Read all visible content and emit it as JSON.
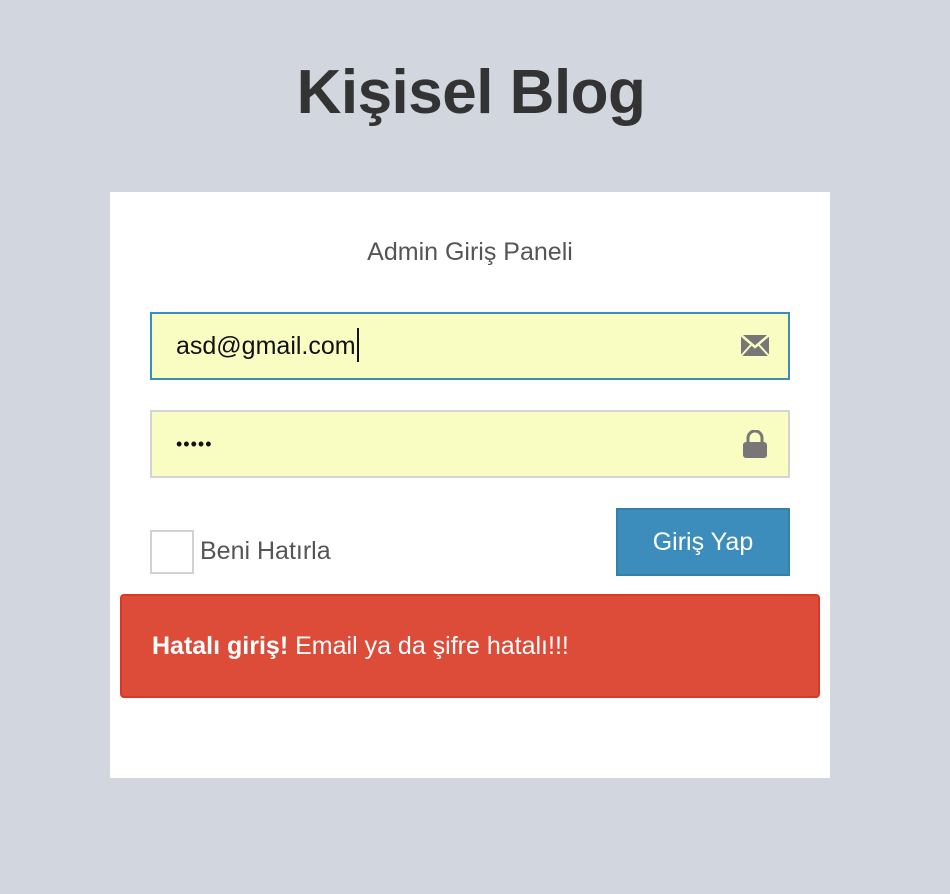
{
  "header": {
    "title": "Kişisel Blog"
  },
  "login_box": {
    "message": "Admin Giriş Paneli",
    "email": {
      "value": "asd@gmail.com",
      "icon": "envelope-icon"
    },
    "password": {
      "masked_value": "•••••",
      "icon": "lock-icon"
    },
    "remember_me": {
      "label": "Beni Hatırla",
      "checked": false
    },
    "submit_label": "Giriş Yap",
    "alert": {
      "title": "Hatalı giriş!",
      "message": "Email ya da şifre hatalı!!!"
    }
  },
  "colors": {
    "background": "#d2d6de",
    "input_autofill": "#fafdc2",
    "primary": "#3c8dbc",
    "danger": "#dd4b39"
  }
}
